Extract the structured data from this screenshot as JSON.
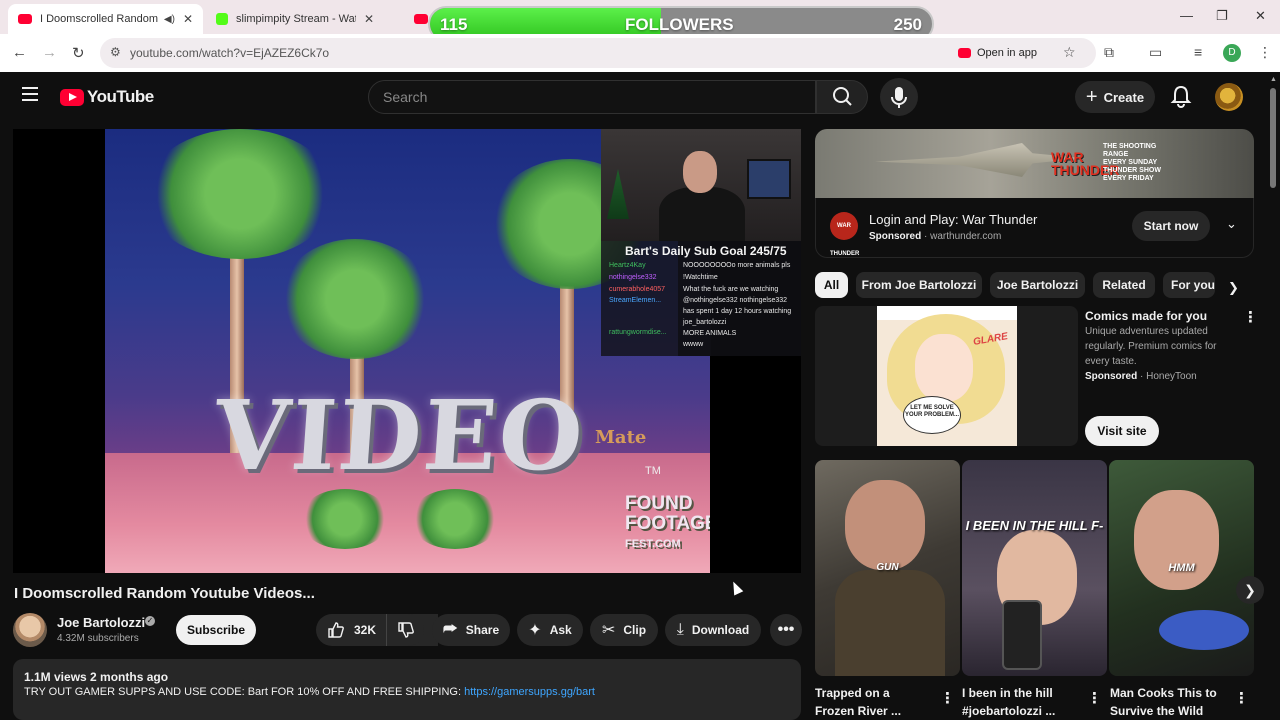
{
  "browser": {
    "tabs": [
      {
        "title": "I Doomscrolled Random Yo",
        "favicon_color": "#ff0033"
      },
      {
        "title": "slimpimpity Stream - Watch Liv",
        "favicon_color": "#53fc18"
      },
      {
        "title": "",
        "favicon_color": "#ff0033"
      }
    ],
    "url": "youtube.com/watch?v=EjAZEZ6Ck7o",
    "open_in_app": "Open in app",
    "profile_initial": "D"
  },
  "followers_overlay": {
    "current": "115",
    "label": "FOLLOWERS",
    "goal": "250",
    "progress": 0.46
  },
  "youtube": {
    "logo_text": "YouTube",
    "search_placeholder": "Search",
    "create_label": "Create"
  },
  "video": {
    "frame_text": "VIDEO",
    "frame_mate": "Mate",
    "frame_tm": "TM",
    "frame_ff": [
      "FOUND",
      "FOOTAGE",
      "FEST.COM"
    ],
    "stream_overlay": {
      "sub_goal": "Bart's Daily Sub Goal 245/75",
      "chat": [
        "NOOOOOOOOo more animals pls",
        "!Watchtime",
        "What the fuck are we watching",
        "@nothingelse332 nothingelse332",
        "has spent 1 day 12 hours watching",
        "joe_bartolozzi",
        "MORE ANIMALS",
        "wwww"
      ],
      "names": [
        "Heartz4Kay",
        "nothingelse332",
        "cumerabhole4057",
        "StreamElemen...",
        "",
        "",
        "rattungwormdise...",
        ""
      ]
    },
    "title": "I Doomscrolled Random Youtube Videos...",
    "channel": {
      "name": "Joe Bartolozzi",
      "subscribers": "4.32M subscribers",
      "subscribe_label": "Subscribe"
    },
    "actions": {
      "likes": "32K",
      "share": "Share",
      "ask": "Ask",
      "clip": "Clip",
      "download": "Download"
    },
    "description": {
      "meta": "1.1M views  2 months ago",
      "text": "TRY OUT GAMER SUPPS AND USE CODE: Bart FOR 10% OFF AND FREE SHIPPING: ",
      "link": "https://gamersupps.gg/bart"
    }
  },
  "sidebar": {
    "ad": {
      "banner_brand": [
        "WAR",
        "THUNDER"
      ],
      "banner_small": [
        "THE SHOOTING",
        "RANGE",
        "EVERY SUNDAY",
        "THUNDER SHOW",
        "EVERY FRIDAY"
      ],
      "logo_text": "WAR THUNDER",
      "title": "Login and Play: War Thunder",
      "sponsored": "Sponsored",
      "domain": "warthunder.com",
      "cta": "Start now"
    },
    "chips": [
      "All",
      "From Joe Bartolozzi",
      "Joe Bartolozzi",
      "Related",
      "For you"
    ],
    "comic_ad": {
      "title": "Comics made for you",
      "description": "Unique adventures updated regularly. Premium comics for every taste.",
      "sponsored": "Sponsored",
      "advertiser": "HoneyToon",
      "cta": "Visit site",
      "art_glare": "GLARE",
      "art_bubble": "LET ME SOLVE YOUR PROBLEM..."
    },
    "shorts": [
      {
        "caption": "GUN",
        "title_line1": "Trapped on a",
        "title_line2": "Frozen River ..."
      },
      {
        "caption": "I BEEN IN THE HILL F-",
        "title_line1": "I been in the hill",
        "title_line2": "#joebartolozzi ..."
      },
      {
        "caption": "HMM",
        "title_line1": "Man Cooks This to",
        "title_line2": "Survive the Wild"
      }
    ]
  },
  "colors": {
    "yt_red": "#ff0033",
    "bg": "#0f0f0f",
    "link": "#3ea6ff",
    "followers_green": "#2fc31f"
  }
}
